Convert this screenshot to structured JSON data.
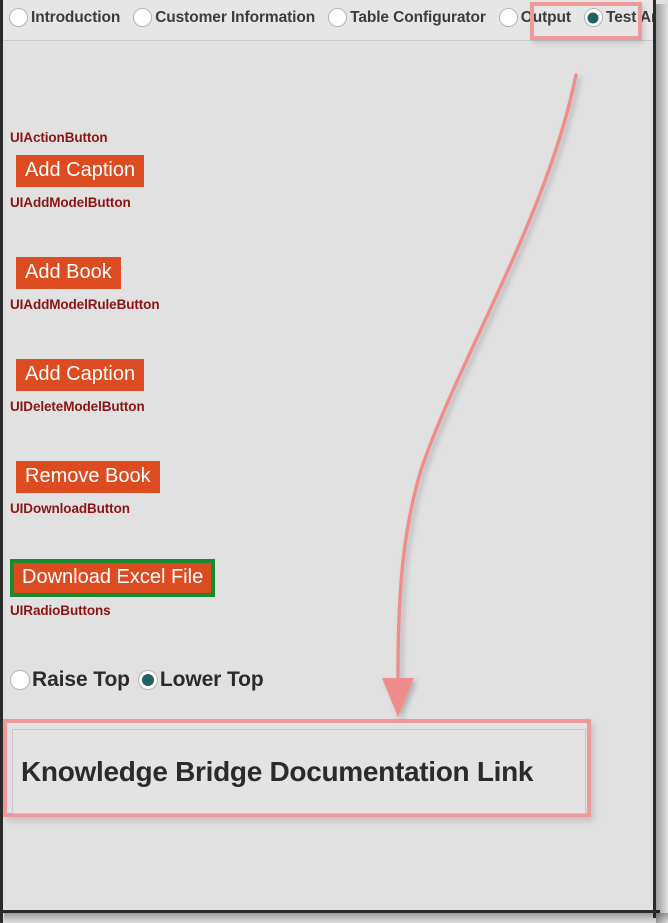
{
  "window": {
    "background_color": "#e1e1e1",
    "border_color": "#2b2b2b"
  },
  "nav": {
    "items": [
      {
        "label": "Introduction",
        "selected": false
      },
      {
        "label": "Customer Information",
        "selected": false
      },
      {
        "label": "Table Configurator",
        "selected": false
      },
      {
        "label": "Output",
        "selected": false
      },
      {
        "label": "Test Area",
        "selected": true
      }
    ],
    "selected_label": "Test Area",
    "highlight_color": "#ef9a9a",
    "radio_selected_color": "#236262"
  },
  "sections": [
    {
      "caption": "UIActionButton",
      "button_label": "Add Caption",
      "button_color": "#dd4b20",
      "highlighted": false
    },
    {
      "caption": "UIAddModelButton",
      "button_label": "Add Book",
      "button_color": "#dd4b20",
      "highlighted": false
    },
    {
      "caption": "UIAddModelRuleButton",
      "button_label": "Add Caption",
      "button_color": "#dd4b20",
      "highlighted": false
    },
    {
      "caption": "UIDeleteModelButton",
      "button_label": "Remove Book",
      "button_color": "#dd4b20",
      "highlighted": false
    },
    {
      "caption": "UIDownloadButton",
      "button_label": "Download Excel File",
      "button_color": "#dd4b20",
      "highlight_color": "#17892f",
      "highlighted": true
    }
  ],
  "radio_section": {
    "caption": "UIRadioButtons",
    "options": [
      {
        "label": "Raise Top",
        "selected": false
      },
      {
        "label": "Lower Top",
        "selected": true
      }
    ]
  },
  "doc_link": {
    "text": "Knowledge Bridge Documentation Link",
    "highlight_color": "#ef9a9a"
  },
  "annotation": {
    "arrow_color": "#ef8d8d",
    "points_to": "Knowledge Bridge Documentation Link"
  }
}
